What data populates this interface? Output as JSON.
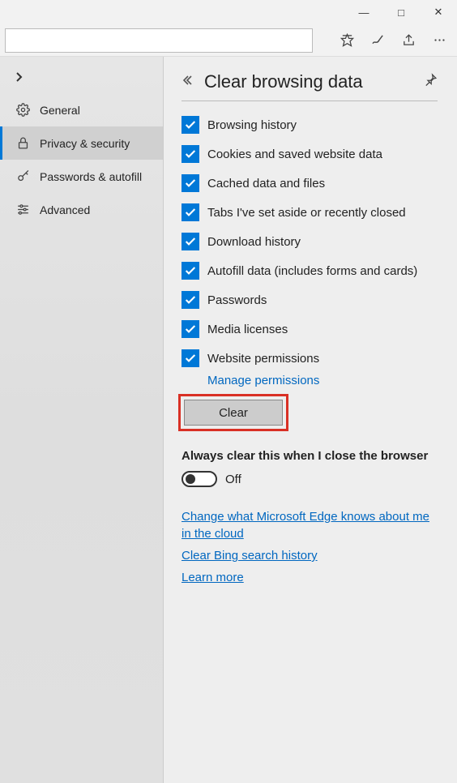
{
  "titlebar": {
    "min": "—",
    "max": "□",
    "close": "✕"
  },
  "toolbar": {
    "url": ""
  },
  "sidebar": {
    "items": [
      {
        "label": "General"
      },
      {
        "label": "Privacy & security"
      },
      {
        "label": "Passwords & autofill"
      },
      {
        "label": "Advanced"
      }
    ]
  },
  "panel": {
    "title": "Clear browsing data",
    "checks": [
      {
        "label": "Browsing history"
      },
      {
        "label": "Cookies and saved website data"
      },
      {
        "label": "Cached data and files"
      },
      {
        "label": "Tabs I've set aside or recently closed"
      },
      {
        "label": "Download history"
      },
      {
        "label": "Autofill data (includes forms and cards)"
      },
      {
        "label": "Passwords"
      },
      {
        "label": "Media licenses"
      },
      {
        "label": "Website permissions"
      }
    ],
    "manage_link": "Manage permissions",
    "clear_button": "Clear",
    "always_clear_label": "Always clear this when I close the browser",
    "toggle_state": "Off",
    "links": {
      "cloud": "Change what Microsoft Edge knows about me in the cloud",
      "bing": "Clear Bing search history",
      "learn": "Learn more"
    }
  }
}
